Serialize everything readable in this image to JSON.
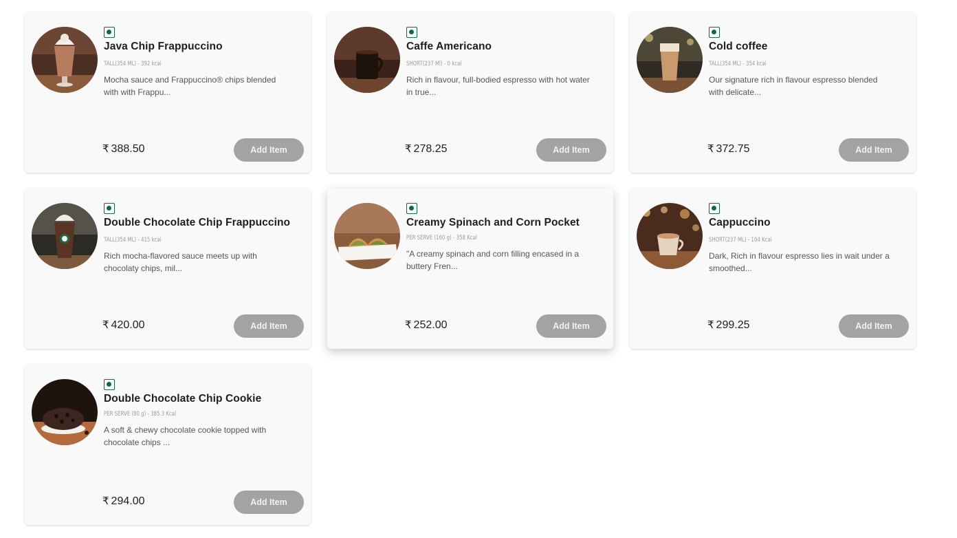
{
  "currency_symbol": "₹",
  "add_label": "Add Item",
  "veg_indicator_color": "#0b6b45",
  "products": [
    {
      "name": "Java Chip Frappuccino",
      "meta": "TALL(354 ML) - 392 kcal",
      "description": "Mocha sauce and Frappuccino® chips blended with with Frappu...",
      "price": "388.50"
    },
    {
      "name": "Caffe Americano",
      "meta": "SHORT(237 Ml) - 0 kcal",
      "description": "Rich in flavour, full-bodied espresso with hot water in true...",
      "price": "278.25"
    },
    {
      "name": "Cold coffee",
      "meta": "TALL(354 ML) - 354 kcal",
      "description": "Our signature rich in flavour espresso blended with delicate...",
      "price": "372.75"
    },
    {
      "name": "Double Chocolate Chip Frappuccino",
      "meta": "TALL(354 ML) - 415 kcal",
      "description": "Rich mocha-flavored sauce meets up with chocolaty chips, mil...",
      "price": "420.00"
    },
    {
      "name": "Creamy Spinach and Corn Pocket",
      "meta": "PER SERVE (160 g) - 358 Kcal",
      "description": "\"A creamy spinach and corn filling encased in a buttery Fren...",
      "price": "252.00"
    },
    {
      "name": "Cappuccino",
      "meta": "SHORT(237 ML) - 104 Kcal",
      "description": "Dark, Rich in flavour espresso lies in wait under a smoothed...",
      "price": "299.25"
    },
    {
      "name": "Double Chocolate Chip Cookie",
      "meta": "PER SERVE (80 g) - 385.3 Kcal",
      "description": "A soft & chewy chocolate cookie topped with chocolate chips ...",
      "price": "294.00"
    }
  ]
}
